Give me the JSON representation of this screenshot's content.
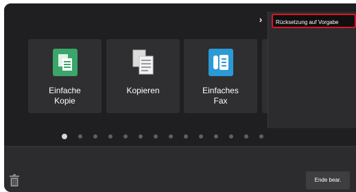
{
  "tiles": [
    {
      "label": "Einfache\nKopie",
      "icon": "simple-copy-icon",
      "color": "#3aa66a"
    },
    {
      "label": "Kopieren",
      "icon": "copy-icon",
      "color": "#e8e8e8"
    },
    {
      "label": "Einfaches\nFax",
      "icon": "simple-fax-icon",
      "color": "#2b9ad6"
    }
  ],
  "side_menu": {
    "expand_icon": "chevron-right-icon",
    "reset_label": "Rücksetzung auf Vorgabe"
  },
  "pagination": {
    "total": 14,
    "current": 1
  },
  "bottom_bar": {
    "trash_icon": "trash-icon",
    "end_edit_label": "Ende bear."
  },
  "colors": {
    "highlight_border": "#e0142a"
  }
}
